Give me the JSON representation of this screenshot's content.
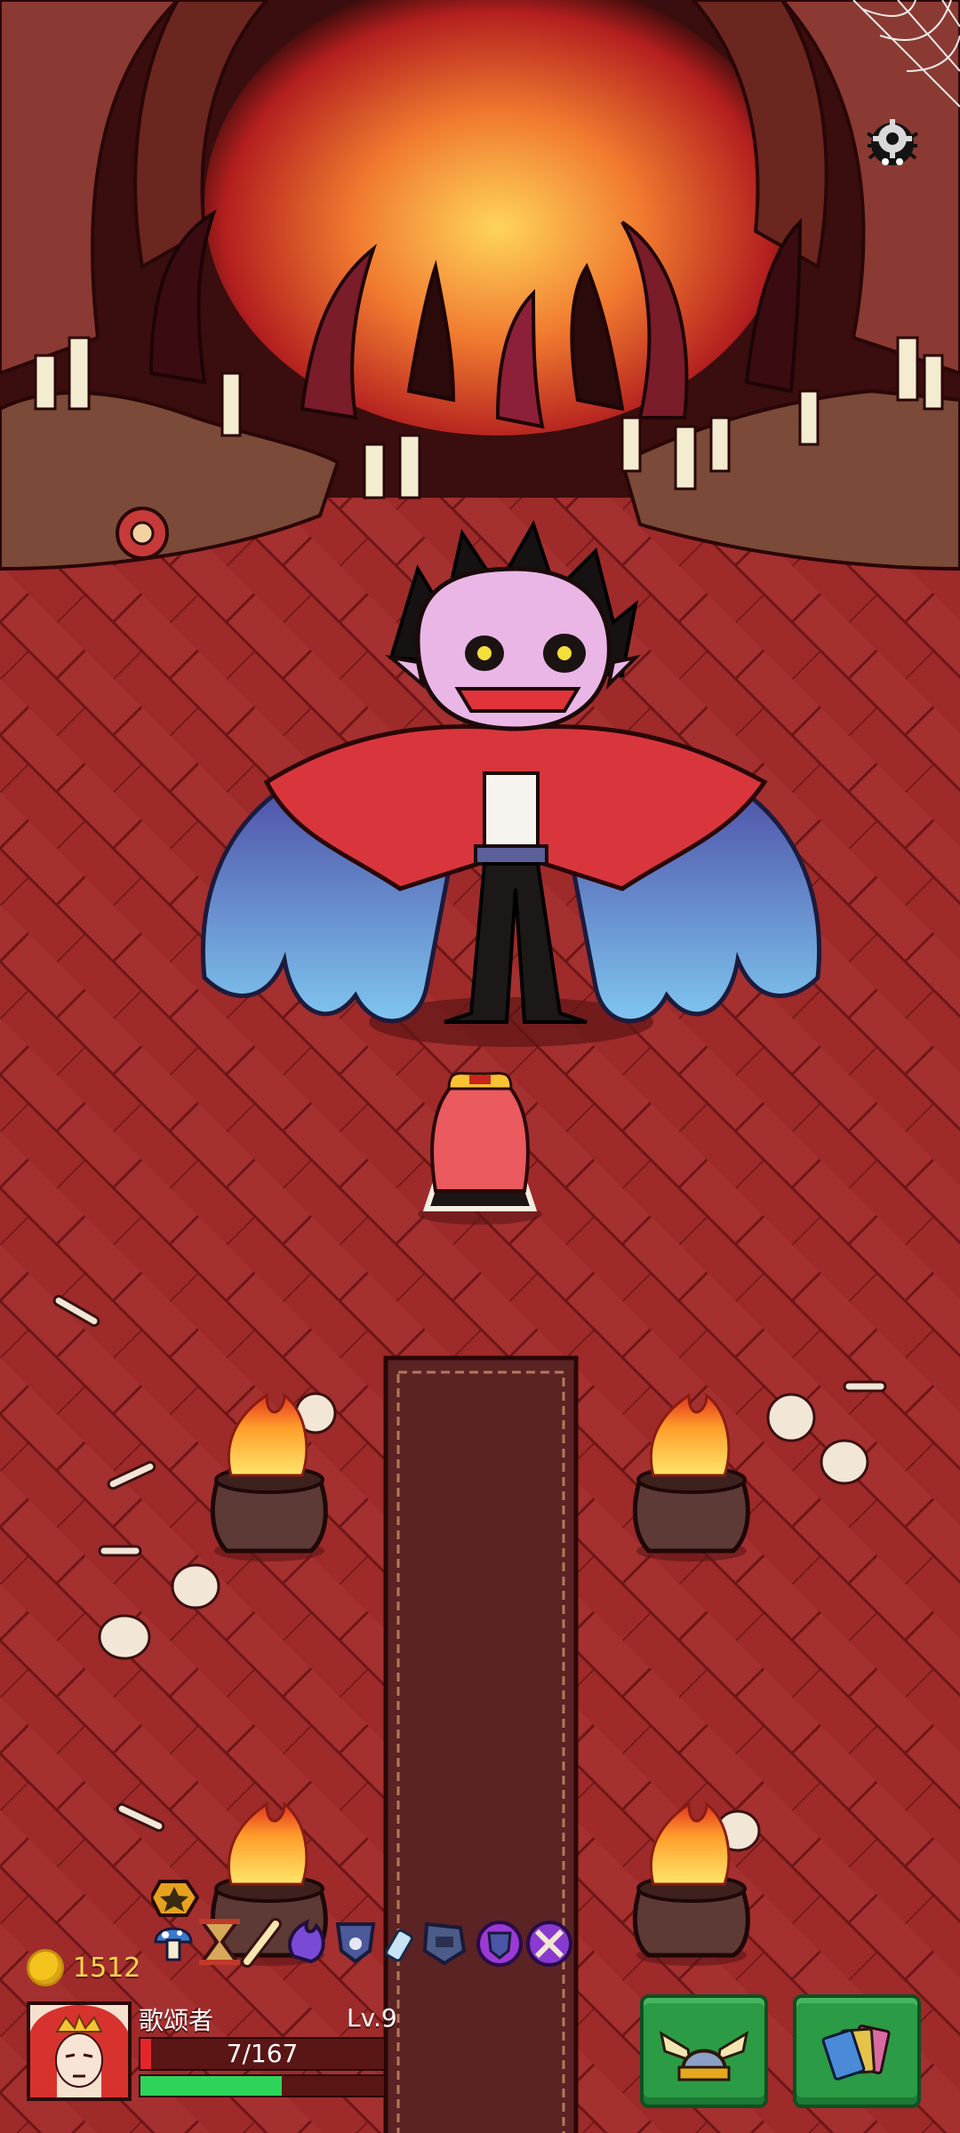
{
  "game": {
    "gold": "1512",
    "hero": {
      "name": "歌颂者",
      "level": "Lv.9",
      "hp_text": "7/167",
      "hp_fraction": 0.042,
      "xp_fraction": 0.58
    }
  },
  "items": [
    "star-badge-icon",
    "mushroom-icon",
    "hourglass-icon",
    "bone-icon",
    "purple-flame-icon",
    "paw-shield-icon",
    "crystal-vial-icon",
    "pentagon-shield-icon",
    "purple-gear-shield-icon",
    "crossed-weapons-icon"
  ],
  "buttons": {
    "helmet": "winged-helmet-icon",
    "cards": "cards-icon"
  },
  "colors": {
    "floor": "#9e2a2a",
    "carpet": "#5b2323",
    "gold": "#ffd84a",
    "hp": "#e4262b",
    "xp": "#2ed45a",
    "button": "#2b9b45"
  }
}
